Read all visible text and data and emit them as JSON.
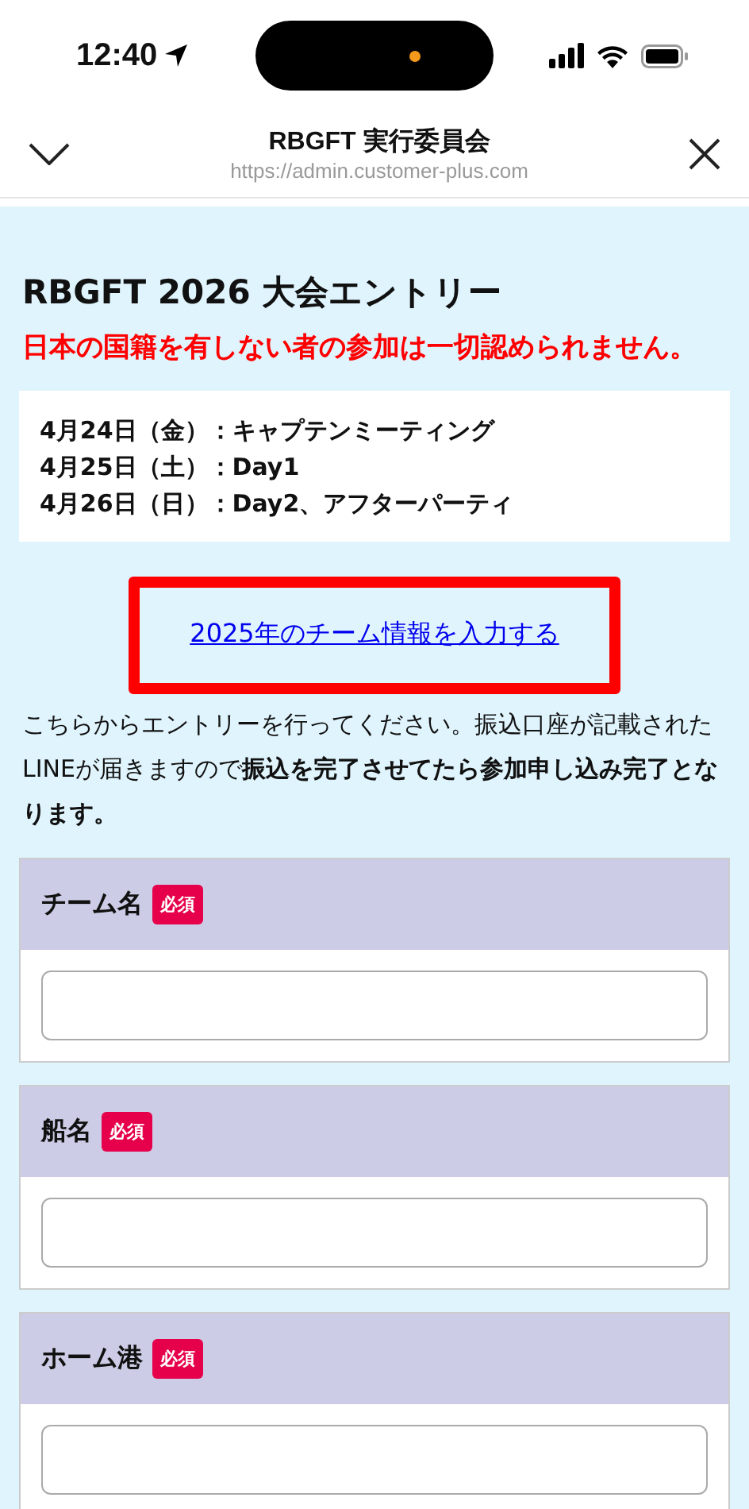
{
  "status_bar": {
    "time": "12:40"
  },
  "browser": {
    "title": "RBGFT 実行委員会",
    "url": "https://admin.customer-plus.com"
  },
  "page": {
    "title": "RBGFT 2026 大会エントリー",
    "notice": "日本の国籍を有しない者の参加は一切認められません。",
    "schedule": [
      "4月24日（金）：キャプテンミーティング",
      "4月25日（土）：Day1",
      "4月26日（日）：Day2、アフターパーティ"
    ],
    "link": "2025年のチーム情報を入力する",
    "description": "こちらからエントリーを行ってください。振込口座が記載されたLINEが届きますので**振込を完了させてたら参加申し込み完了となります。**",
    "fields": [
      {
        "label": "チーム名",
        "badge": "必須"
      },
      {
        "label": "船名",
        "badge": "必須"
      },
      {
        "label": "ホーム港",
        "badge": "必須"
      }
    ]
  }
}
